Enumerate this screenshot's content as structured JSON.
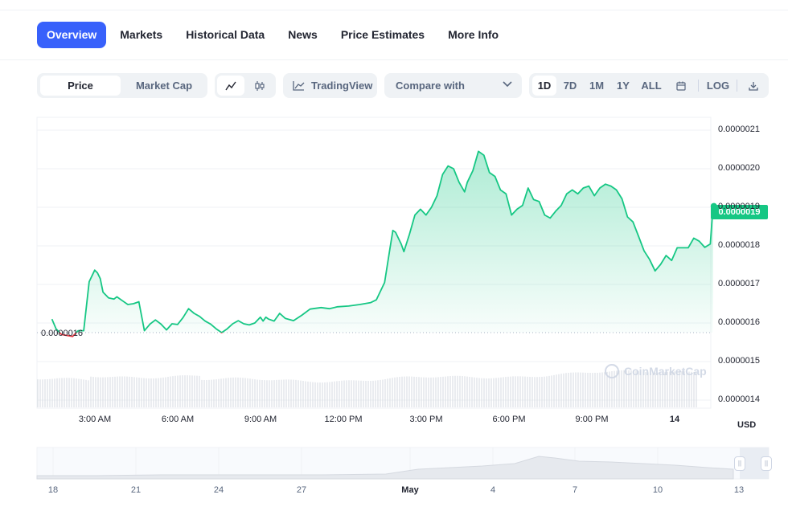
{
  "tabs": [
    "Overview",
    "Markets",
    "Historical Data",
    "News",
    "Price Estimates",
    "More Info"
  ],
  "toolbar": {
    "type_toggle": [
      "Price",
      "Market Cap"
    ],
    "line_icon": "line-chart-icon",
    "candle_icon": "candlestick-icon",
    "tradingview_label": "TradingView",
    "compare_label": "Compare with",
    "ranges": [
      "1D",
      "7D",
      "1M",
      "1Y",
      "ALL"
    ],
    "calendar_icon": "calendar-icon",
    "log_label": "LOG",
    "download_icon": "download-icon"
  },
  "chart": {
    "current_price_label": "0.0000019",
    "reference_label": "0.0000016",
    "currency_label": "USD",
    "watermark": "CoinMarketCap",
    "y_ticks": [
      "0.0000021",
      "0.0000020",
      "0.0000019",
      "0.0000018",
      "0.0000017",
      "0.0000016",
      "0.0000015",
      "0.0000014"
    ],
    "x_ticks": [
      "3:00 AM",
      "6:00 AM",
      "9:00 AM",
      "12:00 PM",
      "3:00 PM",
      "6:00 PM",
      "9:00 PM",
      "14"
    ],
    "navigator_ticks": [
      "18",
      "21",
      "24",
      "27",
      "May",
      "4",
      "7",
      "10",
      "13"
    ]
  },
  "chart_data": {
    "type": "area",
    "ylim": [
      1.39e-06,
      2.12e-06
    ],
    "reference_price": 1.575e-06,
    "up_color": "#16c784",
    "down_color": "#ea3943",
    "x_hours": [
      0.25,
      0.4,
      0.6,
      1.0,
      1.2,
      1.4,
      1.6,
      1.8,
      1.9,
      2.0,
      2.1,
      2.3,
      2.5,
      2.6,
      2.8,
      3.0,
      3.2,
      3.4,
      3.6,
      3.8,
      4.0,
      4.2,
      4.4,
      4.6,
      4.8,
      5.0,
      5.2,
      5.4,
      5.6,
      5.8,
      6.0,
      6.2,
      6.4,
      6.6,
      6.8,
      7.0,
      7.2,
      7.4,
      7.6,
      7.8,
      7.9,
      8.0,
      8.1,
      8.3,
      8.5,
      8.7,
      9.0,
      9.3,
      9.6,
      10.0,
      10.3,
      10.6,
      11.0,
      11.4,
      11.8,
      12.0,
      12.3,
      12.5,
      12.6,
      12.7,
      12.8,
      12.9,
      13.0,
      13.2,
      13.4,
      13.6,
      13.8,
      14.0,
      14.2,
      14.4,
      14.6,
      14.8,
      15.0,
      15.2,
      15.3,
      15.5,
      15.7,
      15.9,
      16.1,
      16.3,
      16.5,
      16.7,
      16.9,
      17.1,
      17.3,
      17.5,
      17.7,
      17.9,
      18.1,
      18.3,
      18.5,
      18.7,
      18.9,
      19.1,
      19.3,
      19.5,
      19.7,
      19.9,
      20.1,
      20.3,
      20.5,
      20.7,
      20.9,
      21.1,
      21.3,
      21.5,
      21.7,
      21.9,
      22.1,
      22.3,
      22.5,
      22.7,
      22.9,
      23.1,
      23.3,
      23.5,
      23.7,
      23.9,
      24.1,
      24.2
    ],
    "values": [
      1.61e-06,
      1.585e-06,
      1.57e-06,
      1.565e-06,
      1.58e-06,
      1.58e-06,
      1.707e-06,
      1.737e-06,
      1.73e-06,
      1.715e-06,
      1.68e-06,
      1.665e-06,
      1.662e-06,
      1.668e-06,
      1.658e-06,
      1.648e-06,
      1.65e-06,
      1.655e-06,
      1.58e-06,
      1.597e-06,
      1.608e-06,
      1.597e-06,
      1.582e-06,
      1.598e-06,
      1.596e-06,
      1.614e-06,
      1.637e-06,
      1.625e-06,
      1.617e-06,
      1.605e-06,
      1.597e-06,
      1.585e-06,
      1.575e-06,
      1.585e-06,
      1.598e-06,
      1.606e-06,
      1.598e-06,
      1.595e-06,
      1.6e-06,
      1.615e-06,
      1.605e-06,
      1.615e-06,
      1.61e-06,
      1.605e-06,
      1.625e-06,
      1.612e-06,
      1.606e-06,
      1.62e-06,
      1.636e-06,
      1.64e-06,
      1.637e-06,
      1.642e-06,
      1.644e-06,
      1.648e-06,
      1.653e-06,
      1.66e-06,
      1.705e-06,
      1.795e-06,
      1.84e-06,
      1.835e-06,
      1.82e-06,
      1.805e-06,
      1.785e-06,
      1.83e-06,
      1.88e-06,
      1.895e-06,
      1.88e-06,
      1.9e-06,
      1.93e-06,
      1.985e-06,
      2.007e-06,
      2e-06,
      1.965e-06,
      1.94e-06,
      1.965e-06,
      1.995e-06,
      2.045e-06,
      2.035e-06,
      1.99e-06,
      1.98e-06,
      1.945e-06,
      1.935e-06,
      1.88e-06,
      1.895e-06,
      1.905e-06,
      1.95e-06,
      1.92e-06,
      1.915e-06,
      1.88e-06,
      1.872e-06,
      1.89e-06,
      1.905e-06,
      1.935e-06,
      1.945e-06,
      1.935e-06,
      1.95e-06,
      1.955e-06,
      1.93e-06,
      1.95e-06,
      1.96e-06,
      1.955e-06,
      1.945e-06,
      1.922e-06,
      1.875e-06,
      1.862e-06,
      1.825e-06,
      1.787e-06,
      1.765e-06,
      1.735e-06,
      1.752e-06,
      1.775e-06,
      1.762e-06,
      1.795e-06,
      1.795e-06,
      1.795e-06,
      1.82e-06,
      1.812e-06,
      1.796e-06,
      1.805e-06,
      1.905e-06
    ]
  }
}
